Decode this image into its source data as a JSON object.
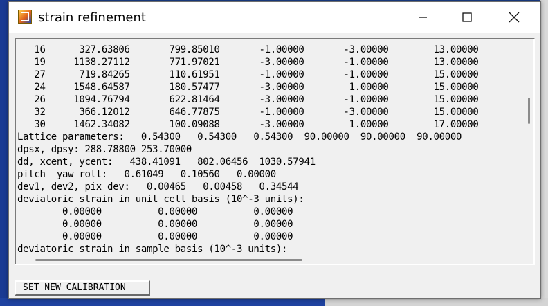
{
  "window": {
    "title": "strain refinement",
    "icon": "app-icon",
    "controls": {
      "minimize": "minimize-icon",
      "maximize": "maximize-icon",
      "close": "close-icon"
    }
  },
  "output": {
    "lines": [
      "   16      327.63806       799.85010       -1.00000       -3.00000        13.00000",
      "   19     1138.27112       771.97021       -3.00000       -1.00000        13.00000",
      "   27      719.84265       110.61951       -1.00000       -1.00000        15.00000",
      "   24     1548.64587       180.57477       -3.00000        1.00000        15.00000",
      "   26     1094.76794       622.81464       -3.00000       -1.00000        15.00000",
      "   32      366.12012       646.77875       -1.00000       -3.00000        15.00000",
      "   30     1462.34082       100.09088       -3.00000        1.00000        17.00000",
      "Lattice parameters:   0.54300   0.54300   0.54300  90.00000  90.00000  90.00000",
      "dpsx, dpsy: 288.78800 253.70000",
      "dd, xcent, ycent:   438.41091   802.06456  1030.57941",
      "pitch  yaw roll:   0.61049   0.10560   0.00000",
      "dev1, dev2, pix dev:   0.00465   0.00458   0.34544",
      "deviatoric strain in unit cell basis (10^-3 units):",
      "        0.00000          0.00000          0.00000",
      "        0.00000          0.00000          0.00000",
      "        0.00000          0.00000          0.00000",
      "deviatoric strain in sample basis (10^-3 units):"
    ]
  },
  "buttons": {
    "set_new_calibration": "SET NEW CALIBRATION"
  },
  "colors": {
    "window_bg": "#f0f0f0",
    "desktop_bg": "#1b3f8e",
    "scroll_thumb": "#8b8b8b"
  }
}
